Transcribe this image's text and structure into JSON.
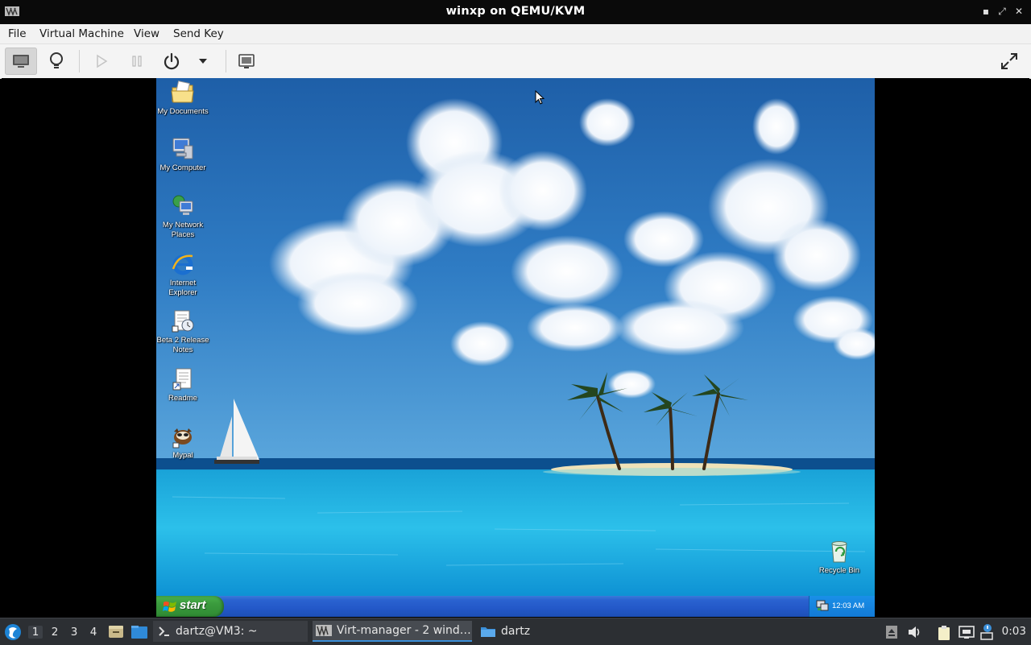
{
  "window": {
    "title": "winxp on QEMU/KVM",
    "minimize_glyph": "▪",
    "maximize_glyph": "⤢",
    "close_glyph": "✕"
  },
  "menubar": {
    "items": [
      "File",
      "Virtual Machine",
      "View",
      "Send Key"
    ]
  },
  "toolbar": {
    "buttons": [
      {
        "icon": "monitor-icon",
        "active": true
      },
      {
        "icon": "lightbulb-icon"
      },
      {
        "icon": "play-icon",
        "disabled": true
      },
      {
        "icon": "pause-icon",
        "disabled": true
      },
      {
        "icon": "power-icon"
      },
      {
        "icon": "dropdown-arrow-icon"
      },
      {
        "icon": "snapshots-icon"
      },
      {
        "icon": "fullscreen-icon"
      }
    ]
  },
  "guest": {
    "desktop_icons": [
      {
        "label": "My Documents",
        "icon": "my-documents-icon"
      },
      {
        "label": "My Computer",
        "icon": "my-computer-icon"
      },
      {
        "label": "My Network\nPlaces",
        "icon": "network-places-icon"
      },
      {
        "label": "Internet\nExplorer",
        "icon": "internet-explorer-icon"
      },
      {
        "label": "Beta 2 Release\nNotes",
        "icon": "release-notes-icon"
      },
      {
        "label": "Readme",
        "icon": "readme-icon"
      },
      {
        "label": "Mypal",
        "icon": "mypal-icon"
      },
      {
        "label": "Recycle Bin",
        "icon": "recycle-bin-icon"
      }
    ],
    "start_label": "start",
    "clock": "12:03 AM"
  },
  "host_taskbar": {
    "workspaces": [
      "1",
      "2",
      "3",
      "4"
    ],
    "active_workspace": "1",
    "tasks": [
      {
        "label": "dartz@VM3: ~",
        "icon": "terminal-icon"
      },
      {
        "label": "Virt-manager - 2 wind…",
        "icon": "virt-manager-icon",
        "active": true
      },
      {
        "label": "dartz",
        "icon": "folder-icon"
      }
    ],
    "clock": "0:03"
  },
  "colors": {
    "xp_taskbar": "#2358c8",
    "xp_start": "#3a9a3d",
    "host_taskbar": "#2c2f33",
    "accent": "#3b8fd9"
  }
}
